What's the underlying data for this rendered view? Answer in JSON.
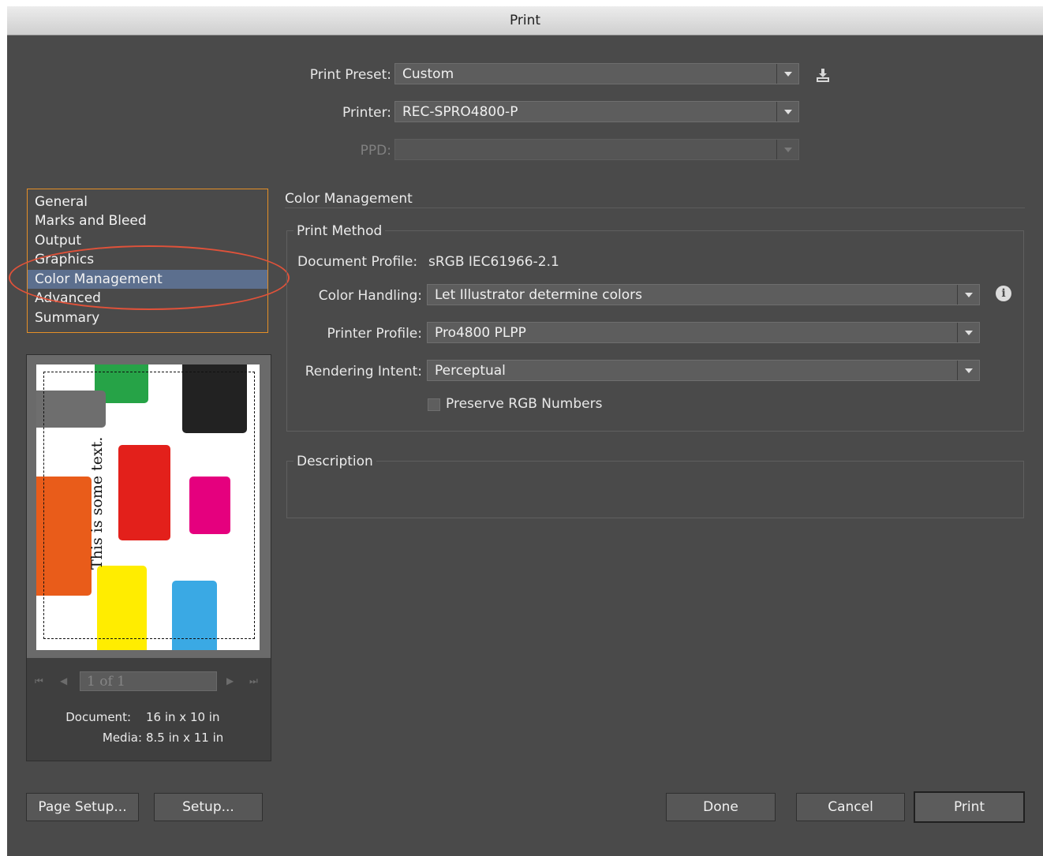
{
  "window": {
    "title": "Print"
  },
  "top": {
    "preset_label": "Print Preset:",
    "preset_value": "Custom",
    "printer_label": "Printer:",
    "printer_value": "REC-SPRO4800-P",
    "ppd_label": "PPD:",
    "ppd_value": "",
    "save_preset_icon": "save-preset-icon"
  },
  "sidebar": {
    "items": [
      {
        "label": "General"
      },
      {
        "label": "Marks and Bleed"
      },
      {
        "label": "Output"
      },
      {
        "label": "Graphics"
      },
      {
        "label": "Color Management"
      },
      {
        "label": "Advanced"
      },
      {
        "label": "Summary"
      }
    ],
    "selected": "Color Management",
    "highlight_color": "#5c6f8e",
    "annotation_color": "#e0523a"
  },
  "preview": {
    "page_text": "This is some text.",
    "page_field": "1 of 1",
    "document_label": "Document:",
    "document_value": "16 in x 10 in",
    "media_label": "Media:",
    "media_value": "8.5 in x 11 in"
  },
  "main": {
    "section_title": "Color Management",
    "print_method": {
      "title": "Print Method",
      "document_profile_label": "Document Profile:",
      "document_profile_value": "sRGB IEC61966-2.1",
      "color_handling_label": "Color Handling:",
      "color_handling_value": "Let Illustrator determine colors",
      "printer_profile_label": "Printer Profile:",
      "printer_profile_value": "Pro4800 PLPP",
      "rendering_intent_label": "Rendering Intent:",
      "rendering_intent_value": "Perceptual",
      "preserve_rgb_label": "Preserve RGB Numbers"
    },
    "description": {
      "title": "Description"
    }
  },
  "buttons": {
    "page_setup": "Page Setup...",
    "setup": "Setup...",
    "done": "Done",
    "cancel": "Cancel",
    "print": "Print"
  }
}
